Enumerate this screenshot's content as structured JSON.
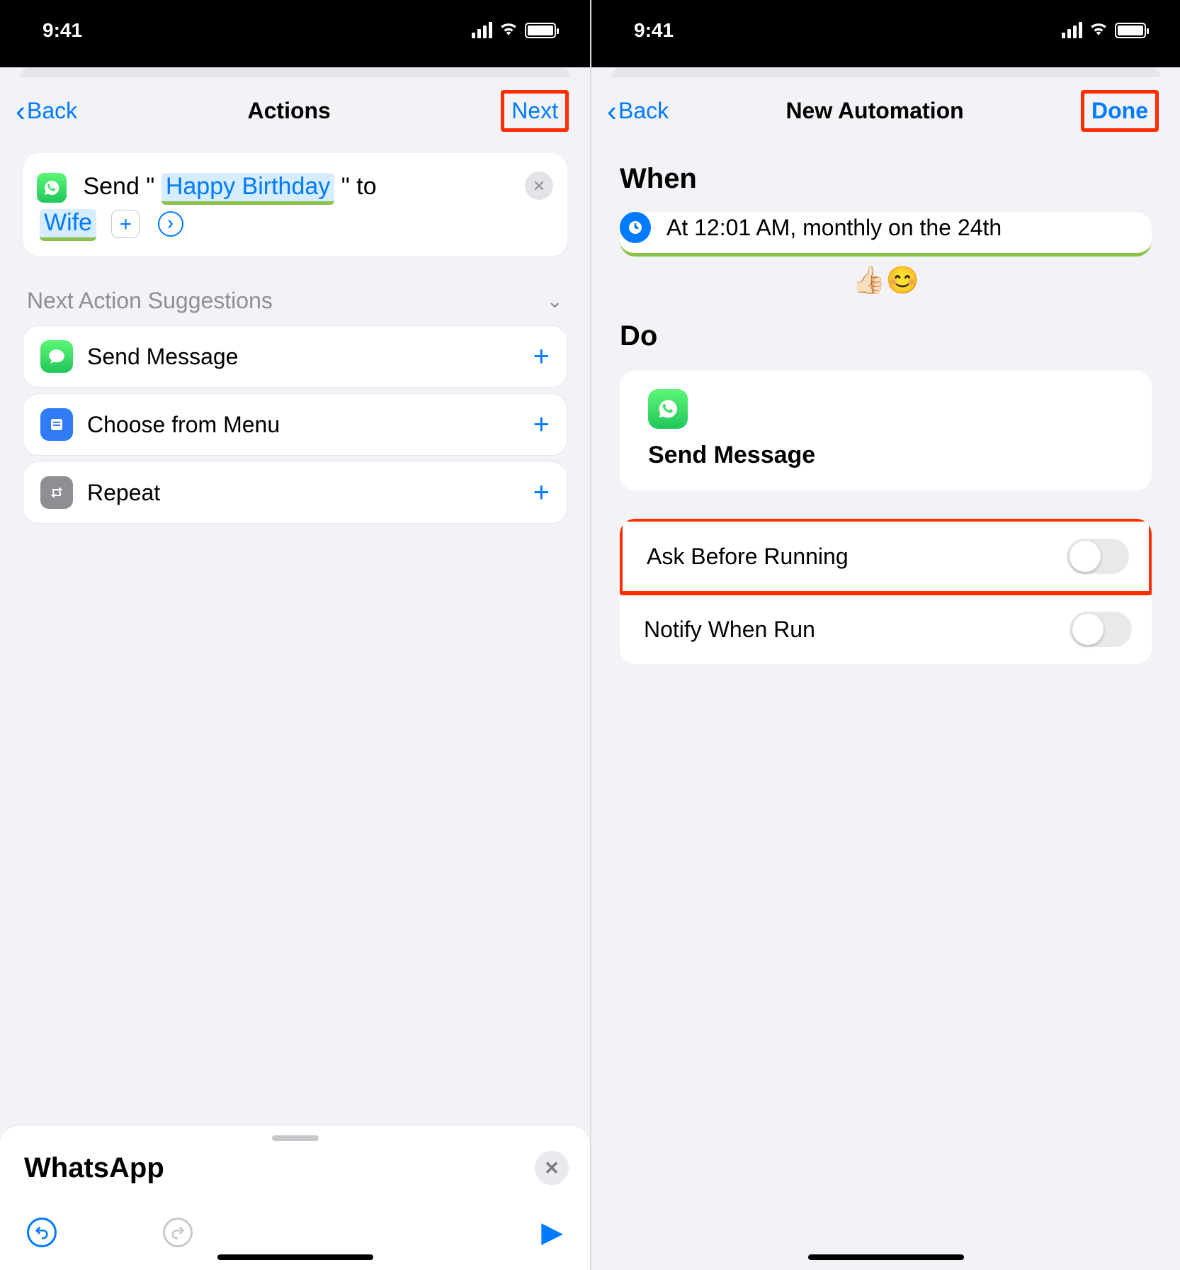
{
  "status": {
    "time": "9:41"
  },
  "left": {
    "nav": {
      "back": "Back",
      "title": "Actions",
      "next": "Next"
    },
    "action": {
      "prefix": "Send \"",
      "message_token": "Happy Birthday",
      "mid": "\" to",
      "recipient_token": "Wife"
    },
    "suggestions_header": "Next Action Suggestions",
    "suggestions": [
      {
        "label": "Send Message"
      },
      {
        "label": "Choose from Menu"
      },
      {
        "label": "Repeat"
      }
    ],
    "bottom": {
      "title": "WhatsApp"
    }
  },
  "right": {
    "nav": {
      "back": "Back",
      "title": "New Automation",
      "done": "Done"
    },
    "when": {
      "title": "When",
      "text": "At 12:01 AM, monthly on the 24th"
    },
    "emoji": "👍🏻😊",
    "do": {
      "title": "Do",
      "action_label": "Send Message"
    },
    "options": {
      "ask": "Ask Before Running",
      "notify": "Notify When Run"
    }
  }
}
